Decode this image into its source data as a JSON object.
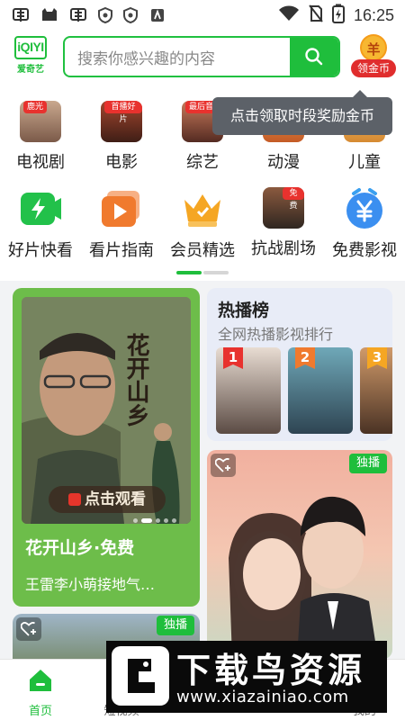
{
  "status_bar": {
    "time": "16:25",
    "left_icons": [
      "app-notification-icon",
      "cat-app-icon",
      "app-notification-icon",
      "shield-icon",
      "shield-icon",
      "a-app-icon"
    ],
    "right_icons": [
      "wifi-icon",
      "no-sim-icon",
      "battery-charging-icon"
    ]
  },
  "header": {
    "logo_mark": "iQIYI",
    "logo_text": "爱奇艺",
    "search_placeholder": "搜索你感兴趣的内容",
    "coin_symbol": "羊",
    "coin_label": "领金币"
  },
  "tooltip": "点击领取时段奖励金币",
  "categories_row1": [
    {
      "label": "电视剧",
      "tag": "鹿光"
    },
    {
      "label": "电影",
      "tag": "首播好片"
    },
    {
      "label": "综艺",
      "tag": "最后音"
    },
    {
      "label": "动漫"
    },
    {
      "label": "儿童"
    }
  ],
  "categories_row2": [
    {
      "label": "好片快看",
      "icon": "lightning-icon"
    },
    {
      "label": "看片指南",
      "icon": "play-icon"
    },
    {
      "label": "会员精选",
      "icon": "crown-icon"
    },
    {
      "label": "抗战剧场",
      "tag": "免费"
    },
    {
      "label": "免费影视",
      "icon": "yuan-icon"
    }
  ],
  "feature_card": {
    "poster_text": "花开山乡",
    "watch_label": "点击观看",
    "title": "花开山乡·免费",
    "subtitle": "王雷李小萌接地气…"
  },
  "rank_card": {
    "title": "热播榜",
    "subtitle": "全网热播影视排行",
    "ranks": [
      "1",
      "2",
      "3"
    ]
  },
  "promo_card": {
    "badge": "独播"
  },
  "small_card": {
    "badge": "独播"
  },
  "bottom_nav": [
    {
      "label": "首页",
      "icon": "home-icon",
      "active": true
    },
    {
      "label": "短视频",
      "icon": "video-icon"
    },
    {
      "label": "",
      "icon": "center-icon"
    },
    {
      "label": "",
      "icon": "vip-icon"
    },
    {
      "label": "我的",
      "icon": "profile-icon"
    }
  ],
  "watermark": {
    "title": "下载鸟资源",
    "url": "www.xiazainiao.com"
  },
  "colors": {
    "brand_green": "#1fbe3c",
    "coin_red": "#e02d2d",
    "tooltip_bg": "#5c6168"
  }
}
